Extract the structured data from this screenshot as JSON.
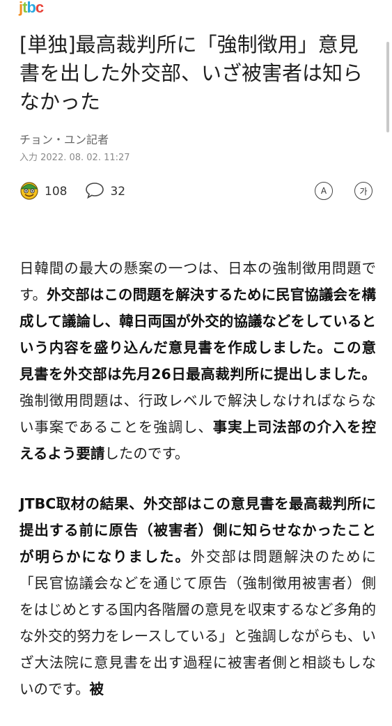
{
  "logo": {
    "text": "jtbc"
  },
  "headline": "[単独]最高裁判所に「強制徴用」意見書を出した外交部、いざ被害者は知らなかった",
  "byline": "チョン・ユン記者",
  "date": "入力 2022. 08. 02. 11:27",
  "reactions": {
    "like_count": "108",
    "comment_count": "32"
  },
  "tools": {
    "font_size": "A",
    "translate": "가"
  },
  "paragraphs": [
    [
      {
        "t": "日韓間の最大の懸案の一つは、日本の強制徴用問題です。",
        "b": false
      },
      {
        "t": "外交部はこの問題を解決するために民官協議会を構成して議論し、韓日両国が外交的協議などをしているという内容を盛り込んだ意見書を作成しました。この意見書を外交部は先月26日最高裁判所に提出しました。",
        "b": true
      },
      {
        "t": "強制徴用問題は、行政レベルで解決しなければならない事案であることを強調し、",
        "b": false
      },
      {
        "t": "事実上司法部の介入を控えるよう要請",
        "b": true
      },
      {
        "t": "したのです。",
        "b": false
      }
    ],
    [
      {
        "t": "JTBC取材の結果、外交部はこの意見書を最高裁判所に提出する前に原告（被害者）側に知らせなかったことが明らかになりました。",
        "b": true
      },
      {
        "t": "外交部は問題解決のために「民官協議会などを通じて原告（強制徴用被害者）側をはじめとする国内各階層の意見を収束するなど多角的な外交的努力をレースしている」と強調しながらも、いざ大法院に意見書を出す過程に被害者側と相談もしないのです。",
        "b": false
      },
      {
        "t": "被",
        "b": true
      }
    ]
  ]
}
